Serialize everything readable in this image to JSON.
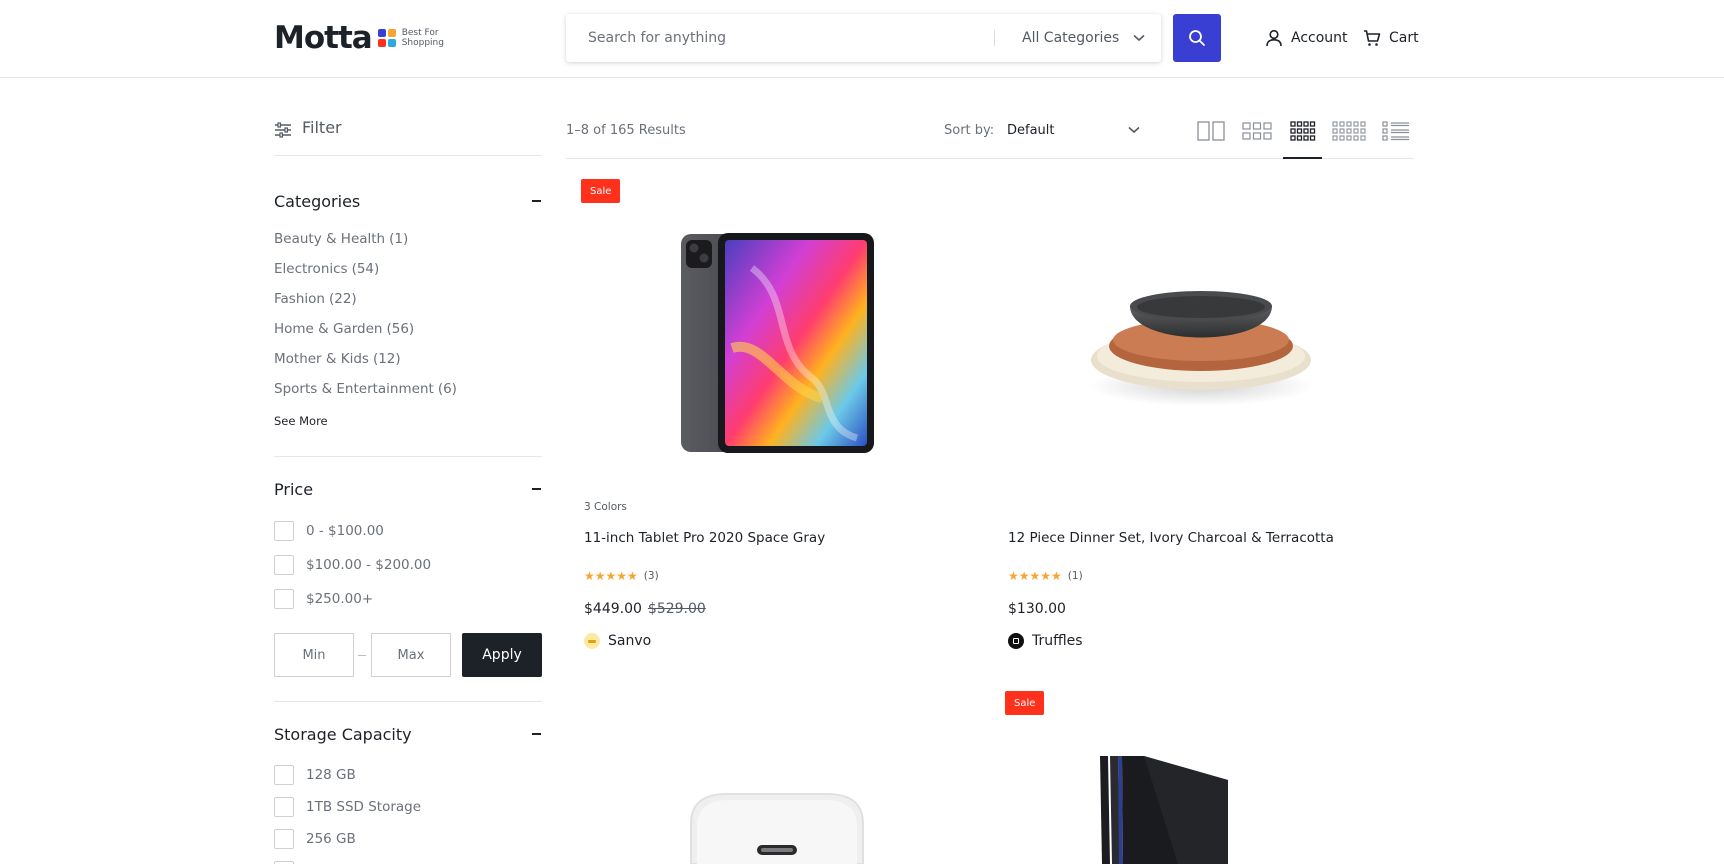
{
  "header": {
    "logo_word": "Motta",
    "logo_tagline_1": "Best For",
    "logo_tagline_2": "Shopping",
    "search_placeholder": "Search for anything",
    "category_select": "All Categories",
    "account_label": "Account",
    "cart_label": "Cart",
    "accent_color": "#3a3fd4"
  },
  "sidebar": {
    "filter_label": "Filter",
    "categories": {
      "title": "Categories",
      "items": [
        {
          "label": "Beauty & Health",
          "count": "(1)"
        },
        {
          "label": "Electronics",
          "count": "(54)"
        },
        {
          "label": "Fashion",
          "count": "(22)"
        },
        {
          "label": "Home & Garden",
          "count": "(56)"
        },
        {
          "label": "Mother & Kids",
          "count": "(12)"
        },
        {
          "label": "Sports & Entertainment",
          "count": "(6)"
        }
      ],
      "see_more": "See More"
    },
    "price": {
      "title": "Price",
      "options": [
        "0 - $100.00",
        "$100.00 - $200.00",
        "$250.00+"
      ],
      "min_placeholder": "Min",
      "max_placeholder": "Max",
      "apply_label": "Apply"
    },
    "storage": {
      "title": "Storage Capacity",
      "options": [
        "128 GB",
        "1TB SSD Storage",
        "256 GB"
      ]
    }
  },
  "toolbar": {
    "results": "1–8 of 165 Results",
    "sort_label": "Sort by:",
    "sort_value": "Default",
    "view_modes": [
      "2-columns-icon",
      "3-columns-icon",
      "4-columns-icon",
      "5-columns-icon",
      "list-view-icon"
    ],
    "active_view": "4-columns-icon"
  },
  "products": [
    {
      "sale_badge": "Sale",
      "colors_label": "3 Colors",
      "name": "11-inch Tablet Pro 2020 Space Gray",
      "stars": "★★★★★",
      "reviews": "(3)",
      "price": "$449.00",
      "old_price": "$529.00",
      "vendor": "Sanvo"
    },
    {
      "name": "12 Piece Dinner Set, Ivory Charcoal & Terracotta",
      "stars": "★★★★★",
      "reviews": "(1)",
      "price": "$130.00",
      "vendor": "Truffles"
    },
    {
      "image": "white-charger"
    },
    {
      "sale_badge": "Sale",
      "image": "black-console"
    }
  ],
  "colors": {
    "sale_red": "#ff311c",
    "star_orange": "#f7a531",
    "dark": "#1d2128"
  }
}
